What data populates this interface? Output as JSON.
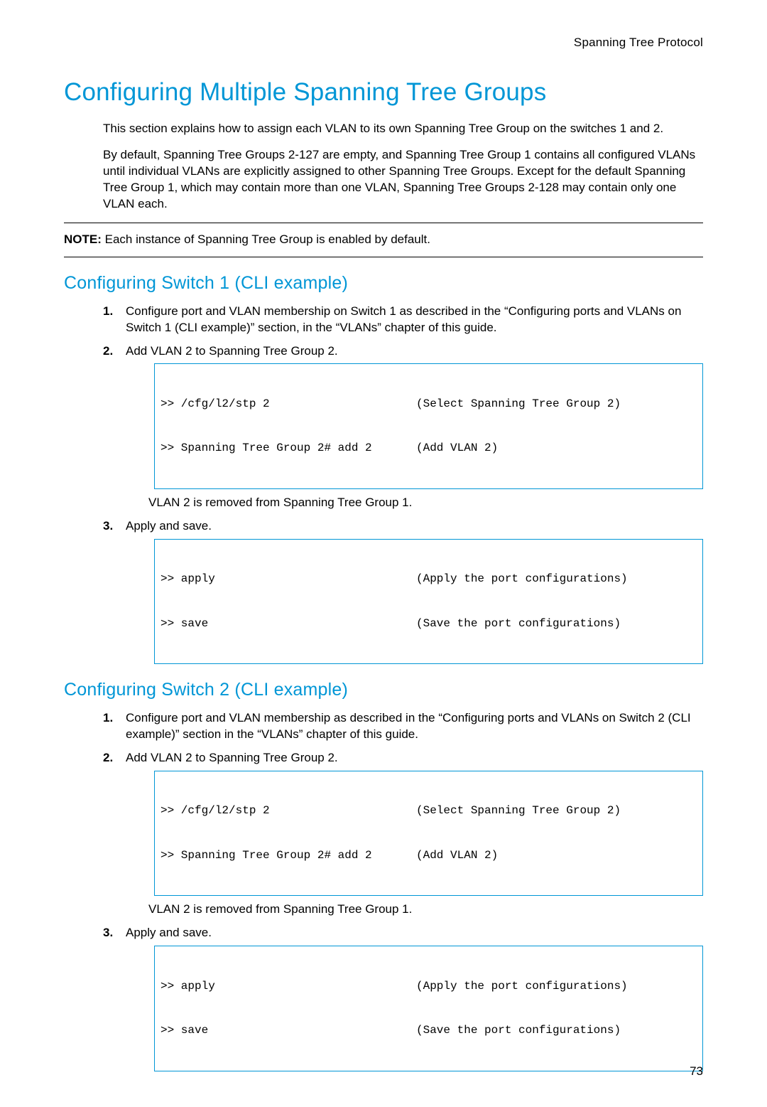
{
  "header": {
    "running": "Spanning Tree Protocol"
  },
  "main": {
    "title": "Configuring Multiple Spanning Tree Groups",
    "intro1": "This section explains how to assign each VLAN to its own Spanning Tree Group on the switches 1 and 2.",
    "intro2": "By default, Spanning Tree Groups 2-127 are empty, and Spanning Tree Group 1 contains all configured VLANs until individual VLANs are explicitly assigned to other Spanning Tree Groups. Except for the default Spanning Tree Group 1, which may contain more than one VLAN, Spanning Tree Groups 2-128 may contain only one VLAN each.",
    "note_label": "NOTE:",
    "note_text": " Each instance of Spanning Tree Group is enabled by default."
  },
  "section1": {
    "title": "Configuring Switch 1 (CLI example)",
    "items": [
      {
        "num": "1.",
        "text": "Configure port and VLAN membership on Switch 1 as described in the “Configuring ports and VLANs on Switch 1 (CLI example)” section, in the “VLANs” chapter of this guide."
      },
      {
        "num": "2.",
        "text": "Add VLAN 2 to Spanning Tree Group 2.",
        "code": [
          {
            "l": ">> /cfg/l2/stp 2",
            "r": "(Select Spanning Tree Group 2)"
          },
          {
            "l": ">> Spanning Tree Group 2# add 2",
            "r": "(Add VLAN 2)"
          }
        ],
        "after": "VLAN 2 is removed from Spanning Tree Group 1."
      },
      {
        "num": "3.",
        "text": "Apply and save.",
        "code": [
          {
            "l": ">> apply",
            "r": "(Apply the port configurations)"
          },
          {
            "l": ">> save",
            "r": "(Save the port configurations)"
          }
        ]
      }
    ]
  },
  "section2": {
    "title": "Configuring Switch 2 (CLI example)",
    "items": [
      {
        "num": "1.",
        "text": "Configure port and VLAN membership as described in the “Configuring ports and VLANs on Switch 2 (CLI example)” section in the “VLANs” chapter of this guide."
      },
      {
        "num": "2.",
        "text": "Add VLAN 2 to Spanning Tree Group 2.",
        "code": [
          {
            "l": ">> /cfg/l2/stp 2",
            "r": "(Select Spanning Tree Group 2)"
          },
          {
            "l": ">> Spanning Tree Group 2# add 2",
            "r": "(Add VLAN 2)"
          }
        ],
        "after": "VLAN 2 is removed from Spanning Tree Group 1."
      },
      {
        "num": "3.",
        "text": "Apply and save.",
        "code": [
          {
            "l": ">> apply",
            "r": "(Apply the port configurations)"
          },
          {
            "l": ">> save",
            "r": "(Save the port configurations)"
          }
        ]
      }
    ]
  },
  "footer": {
    "page": "73"
  }
}
